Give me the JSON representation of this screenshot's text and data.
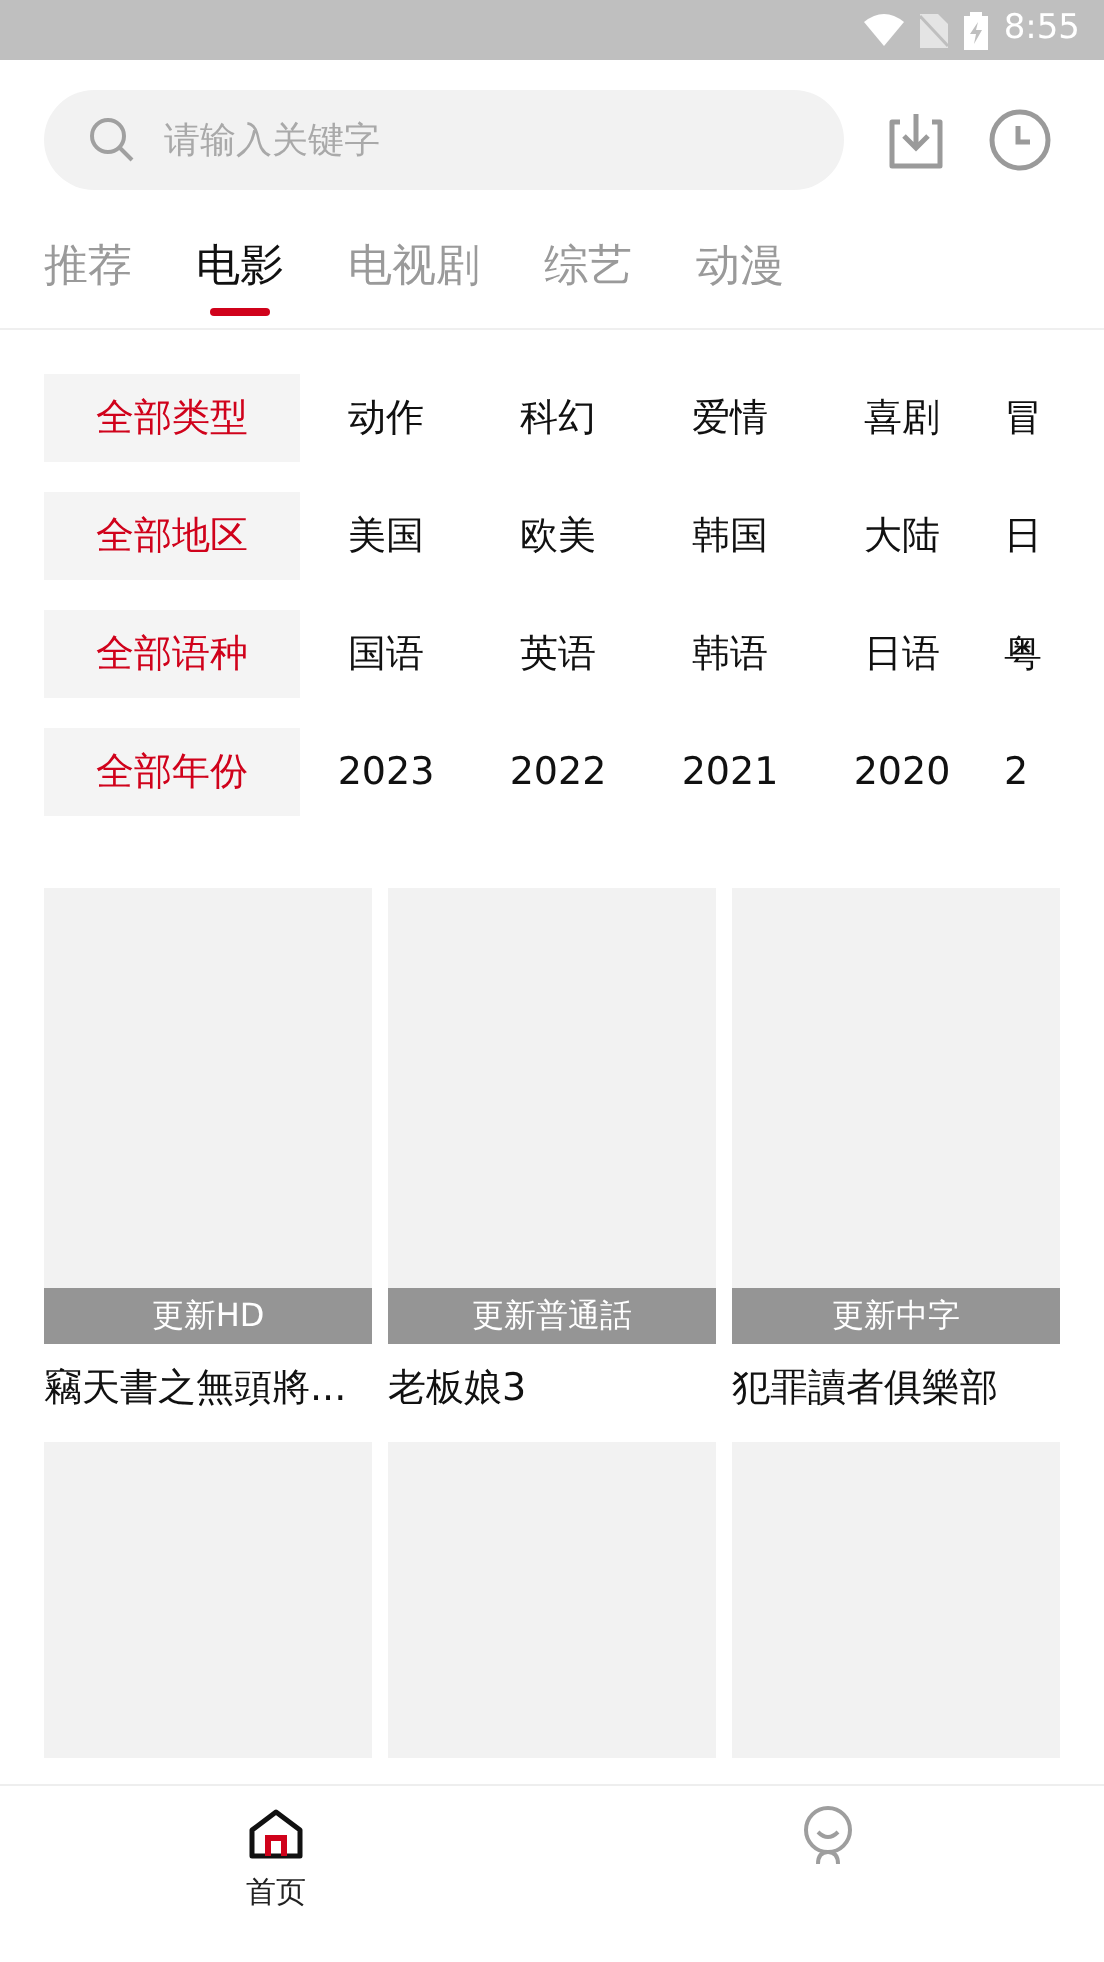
{
  "status_bar": {
    "time": "8:55"
  },
  "search": {
    "placeholder": "请输入关键字"
  },
  "tabs": [
    {
      "label": "推荐",
      "selected": false
    },
    {
      "label": "电影",
      "selected": true
    },
    {
      "label": "电视剧",
      "selected": false
    },
    {
      "label": "综艺",
      "selected": false
    },
    {
      "label": "动漫",
      "selected": false
    }
  ],
  "filters": [
    {
      "options": [
        {
          "label": "全部类型",
          "selected": true
        },
        {
          "label": "动作",
          "selected": false
        },
        {
          "label": "科幻",
          "selected": false
        },
        {
          "label": "爱情",
          "selected": false
        },
        {
          "label": "喜剧",
          "selected": false
        },
        {
          "label": "冒",
          "selected": false
        }
      ]
    },
    {
      "options": [
        {
          "label": "全部地区",
          "selected": true
        },
        {
          "label": "美国",
          "selected": false
        },
        {
          "label": "欧美",
          "selected": false
        },
        {
          "label": "韩国",
          "selected": false
        },
        {
          "label": "大陆",
          "selected": false
        },
        {
          "label": "日",
          "selected": false
        }
      ]
    },
    {
      "options": [
        {
          "label": "全部语种",
          "selected": true
        },
        {
          "label": "国语",
          "selected": false
        },
        {
          "label": "英语",
          "selected": false
        },
        {
          "label": "韩语",
          "selected": false
        },
        {
          "label": "日语",
          "selected": false
        },
        {
          "label": "粤",
          "selected": false
        }
      ]
    },
    {
      "options": [
        {
          "label": "全部年份",
          "selected": true
        },
        {
          "label": "2023",
          "selected": false
        },
        {
          "label": "2022",
          "selected": false
        },
        {
          "label": "2021",
          "selected": false
        },
        {
          "label": "2020",
          "selected": false
        },
        {
          "label": "2",
          "selected": false
        }
      ]
    }
  ],
  "cards": [
    {
      "kind": "full",
      "badge": "更新HD",
      "title": "竊天書之無頭將..."
    },
    {
      "kind": "full",
      "badge": "更新普通話",
      "title": "老板娘3"
    },
    {
      "kind": "full",
      "badge": "更新中字",
      "title": "犯罪讀者俱樂部"
    },
    {
      "kind": "partial"
    },
    {
      "kind": "partial"
    },
    {
      "kind": "partial"
    }
  ],
  "bottom_nav": [
    {
      "kind": "home",
      "label": "首页",
      "selected": true
    },
    {
      "kind": "profile",
      "selected": false
    }
  ]
}
